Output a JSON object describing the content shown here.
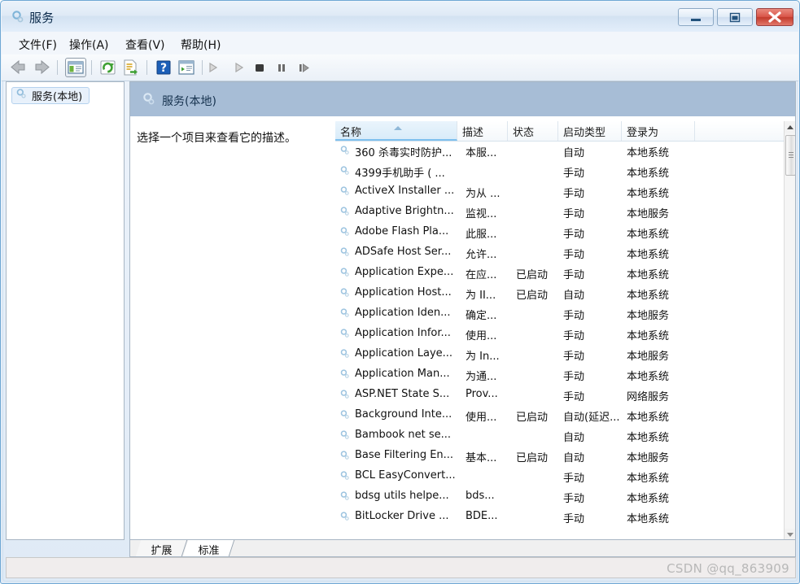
{
  "window": {
    "title": "服务",
    "title_icon": "services-gear-icon",
    "controls": {
      "minimize": "最小化",
      "maximize": "最大化",
      "close": "关闭"
    }
  },
  "menubar": {
    "items": [
      {
        "label": "文件(F)",
        "name": "menu-file"
      },
      {
        "label": "操作(A)",
        "name": "menu-action"
      },
      {
        "label": "查看(V)",
        "name": "menu-view"
      },
      {
        "label": "帮助(H)",
        "name": "menu-help"
      }
    ]
  },
  "toolbar": {
    "buttons": [
      {
        "name": "back-arrow-icon",
        "tip": "后退"
      },
      {
        "name": "forward-arrow-icon",
        "tip": "前进"
      },
      {
        "name": "show-hide-console-tree-icon",
        "tip": "显示/隐藏控制台树"
      },
      {
        "name": "refresh-icon",
        "tip": "刷新"
      },
      {
        "name": "export-list-icon",
        "tip": "导出列表"
      },
      {
        "name": "help-icon",
        "tip": "帮助"
      },
      {
        "name": "show-action-pane-icon",
        "tip": "显示/隐藏操作窗格"
      },
      {
        "name": "start-service-icon",
        "tip": "启动服务"
      },
      {
        "name": "resume-service-icon",
        "tip": "恢复服务"
      },
      {
        "name": "stop-service-icon",
        "tip": "停止服务"
      },
      {
        "name": "pause-service-icon",
        "tip": "暂停服务"
      },
      {
        "name": "restart-service-icon",
        "tip": "重启服务"
      }
    ]
  },
  "tree": {
    "node_label": "服务(本地)",
    "node_icon": "services-gear-icon"
  },
  "pane": {
    "header_title": "服务(本地)",
    "header_icon": "services-gear-icon",
    "description": "选择一个项目来查看它的描述。"
  },
  "list": {
    "columns": [
      {
        "label": "名称",
        "name": "column-name",
        "sorted": true,
        "sort_dir": "asc"
      },
      {
        "label": "描述",
        "name": "column-description",
        "sorted": false
      },
      {
        "label": "状态",
        "name": "column-status",
        "sorted": false
      },
      {
        "label": "启动类型",
        "name": "column-startup-type",
        "sorted": false
      },
      {
        "label": "登录为",
        "name": "column-log-on-as",
        "sorted": false
      }
    ],
    "rows": [
      {
        "name": "360 杀毒实时防护...",
        "description": "本服...",
        "status": "",
        "startup": "自动",
        "logon": "本地系统"
      },
      {
        "name": "4399手机助手 ( ...",
        "description": "",
        "status": "",
        "startup": "手动",
        "logon": "本地系统"
      },
      {
        "name": "ActiveX Installer ...",
        "description": "为从 ...",
        "status": "",
        "startup": "手动",
        "logon": "本地系统"
      },
      {
        "name": "Adaptive Brightn...",
        "description": "监视...",
        "status": "",
        "startup": "手动",
        "logon": "本地服务"
      },
      {
        "name": "Adobe Flash Pla...",
        "description": "此服...",
        "status": "",
        "startup": "手动",
        "logon": "本地系统"
      },
      {
        "name": "ADSafe Host Ser...",
        "description": "允许...",
        "status": "",
        "startup": "手动",
        "logon": "本地系统"
      },
      {
        "name": "Application Expe...",
        "description": "在应...",
        "status": "已启动",
        "startup": "手动",
        "logon": "本地系统"
      },
      {
        "name": "Application Host...",
        "description": "为 II...",
        "status": "已启动",
        "startup": "自动",
        "logon": "本地系统"
      },
      {
        "name": "Application Iden...",
        "description": "确定...",
        "status": "",
        "startup": "手动",
        "logon": "本地服务"
      },
      {
        "name": "Application Infor...",
        "description": "使用...",
        "status": "",
        "startup": "手动",
        "logon": "本地系统"
      },
      {
        "name": "Application Laye...",
        "description": "为 In...",
        "status": "",
        "startup": "手动",
        "logon": "本地服务"
      },
      {
        "name": "Application Man...",
        "description": "为通...",
        "status": "",
        "startup": "手动",
        "logon": "本地系统"
      },
      {
        "name": "ASP.NET State S...",
        "description": "Prov...",
        "status": "",
        "startup": "手动",
        "logon": "网络服务"
      },
      {
        "name": "Background Inte...",
        "description": "使用...",
        "status": "已启动",
        "startup": "自动(延迟...",
        "logon": "本地系统"
      },
      {
        "name": "Bambook net se...",
        "description": "",
        "status": "",
        "startup": "自动",
        "logon": "本地系统"
      },
      {
        "name": "Base Filtering En...",
        "description": "基本...",
        "status": "已启动",
        "startup": "自动",
        "logon": "本地服务"
      },
      {
        "name": "BCL EasyConvert...",
        "description": "",
        "status": "",
        "startup": "手动",
        "logon": "本地系统"
      },
      {
        "name": "bdsg utils helpe...",
        "description": "bds...",
        "status": "",
        "startup": "手动",
        "logon": "本地系统"
      },
      {
        "name": "BitLocker Drive ...",
        "description": "BDE...",
        "status": "",
        "startup": "手动",
        "logon": "本地系统"
      }
    ],
    "row_icon": "service-gear-icon"
  },
  "tabs": [
    {
      "label": "扩展",
      "name": "tab-extended",
      "active": false
    },
    {
      "label": "标准",
      "name": "tab-standard",
      "active": true
    }
  ],
  "statusbar": {
    "text": ""
  },
  "watermark": "CSDN @qq_863909",
  "colors": {
    "window_border": "#6fa8d4",
    "pane_header": "#a7bdd6",
    "close_button": "#c23a2c",
    "sorted_column": "#d9ecf9"
  }
}
